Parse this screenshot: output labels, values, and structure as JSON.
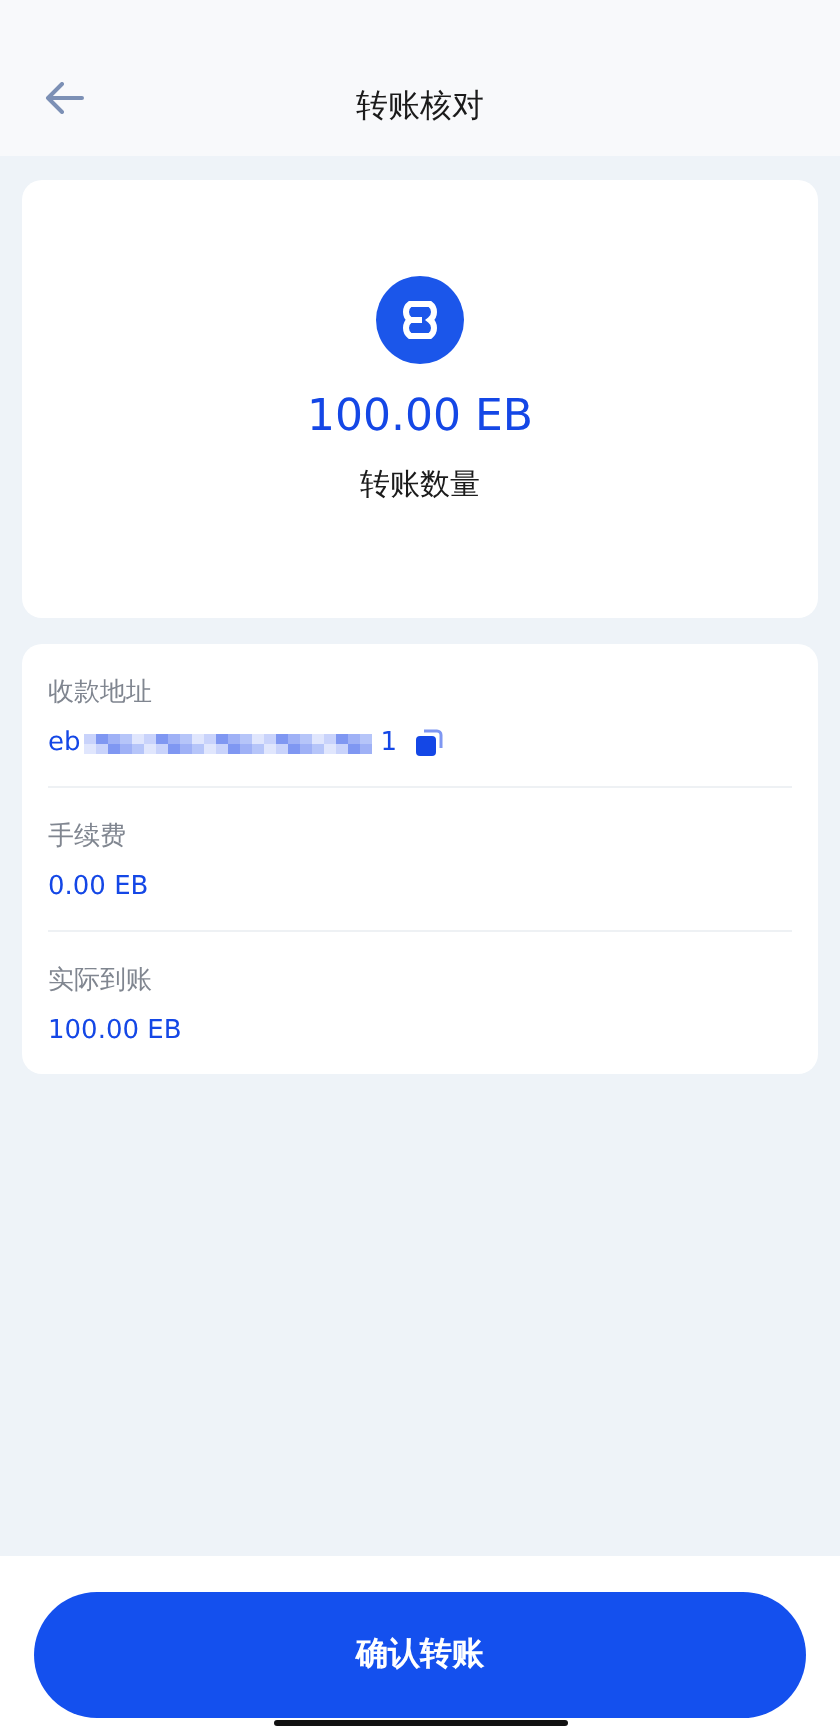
{
  "header": {
    "title": "转账核对"
  },
  "summary": {
    "amount": "100.00 EB",
    "label": "转账数量"
  },
  "details": [
    {
      "kind": "address",
      "label": "收款地址",
      "value_start": "eb",
      "value_end": "1"
    },
    {
      "kind": "text",
      "label": "手续费",
      "value": "0.00 EB"
    },
    {
      "kind": "text",
      "label": "实际到账",
      "value": "100.00 EB"
    }
  ],
  "confirm_button": "确认转账"
}
